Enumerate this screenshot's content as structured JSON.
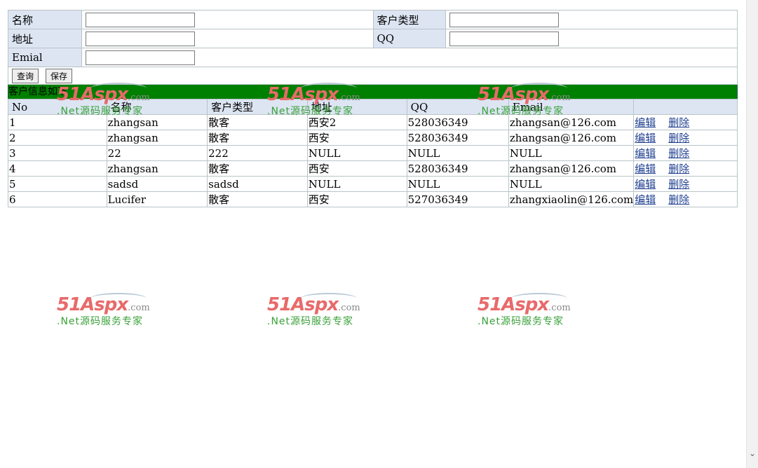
{
  "form": {
    "name_label": "名称",
    "customer_type_label": "客户类型",
    "address_label": "地址",
    "qq_label": "QQ",
    "email_label": "Emial",
    "name_value": "",
    "customer_type_value": "",
    "address_value": "",
    "qq_value": "",
    "email_value": "",
    "query_button": "查询",
    "save_button": "保存"
  },
  "grid": {
    "title": "客户信息如下",
    "headers": [
      "No",
      "名称",
      "客户类型",
      "地址",
      "QQ",
      "Email"
    ],
    "rows": [
      [
        "1",
        "zhangsan",
        "散客",
        "西安2",
        "528036349",
        "zhangsan@126.com"
      ],
      [
        "2",
        "zhangsan",
        "散客",
        "西安",
        "528036349",
        "zhangsan@126.com"
      ],
      [
        "3",
        "22",
        "222",
        "NULL",
        "NULL",
        "NULL"
      ],
      [
        "4",
        "zhangsan",
        "散客",
        "西安",
        "528036349",
        "zhangsan@126.com"
      ],
      [
        "5",
        "sadsd",
        "sadsd",
        "NULL",
        "NULL",
        "NULL"
      ],
      [
        "6",
        "Lucifer",
        "散客",
        "西安",
        "527036349",
        "zhangxiaolin@126.com"
      ]
    ],
    "edit_label": "编辑",
    "delete_label": "删除"
  },
  "watermark": {
    "brand": "51Aspx",
    "domain": ".com",
    "slogan": ".Net源码服务专家"
  },
  "icons": {
    "scroll_down": "chevron-down-icon"
  },
  "colors": {
    "title_bar": "#008000",
    "label_bg": "#dde5f3",
    "border": "#1f5b50"
  }
}
